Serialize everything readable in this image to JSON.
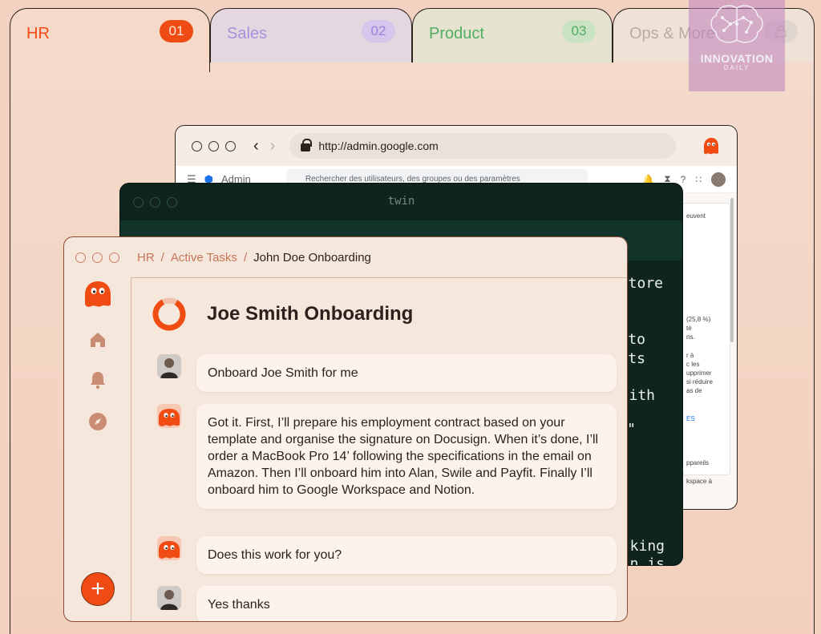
{
  "tabs": [
    {
      "label": "HR",
      "number": "01"
    },
    {
      "label": "Sales",
      "number": "02"
    },
    {
      "label": "Product",
      "number": "03"
    },
    {
      "label": "Ops & More",
      "number": ""
    }
  ],
  "watermark": {
    "title": "INNOVATION",
    "subtitle": "DAILY"
  },
  "browser": {
    "url": "http://admin.google.com",
    "admin_label": "Admin",
    "search_placeholder": "Rechercher des utilisateurs, des groupes ou des paramètres",
    "side_text": [
      "euvent",
      "(25,8 %)",
      "té",
      "ns.",
      "r à",
      "c les",
      "upprimer",
      "si réduire",
      "as de",
      "ES",
      "ppareils",
      "kspace à"
    ]
  },
  "terminal": {
    "title": "twin",
    "lines": [
      "tore",
      "to",
      "ts",
      "ith",
      "\"",
      "king",
      "n is"
    ]
  },
  "app": {
    "breadcrumb": {
      "root": "HR",
      "section": "Active Tasks",
      "current": "John Doe Onboarding"
    },
    "task_title": "Joe Smith Onboarding",
    "fab_label": "+",
    "messages": [
      {
        "sender": "user",
        "text": "Onboard Joe Smith for me"
      },
      {
        "sender": "bot",
        "text": "Got it. First, I’ll prepare his employment contract based on your template and organise the signature on Docusign. When it’s done, I’ll order a MacBook Pro 14’ following the specifications in the email on Amazon. Then I’ll onboard him into Alan, Swile and Payfit. Finally I’ll onboard him to Google Workspace and Notion."
      },
      {
        "sender": "bot",
        "text": "Does this work for you?"
      },
      {
        "sender": "user",
        "text": "Yes thanks"
      }
    ]
  },
  "colors": {
    "accent": "#f04b12",
    "background": "#f3d2c2",
    "sales": "#a690df",
    "product": "#4fae63",
    "terminal_bg": "#0e241d"
  }
}
